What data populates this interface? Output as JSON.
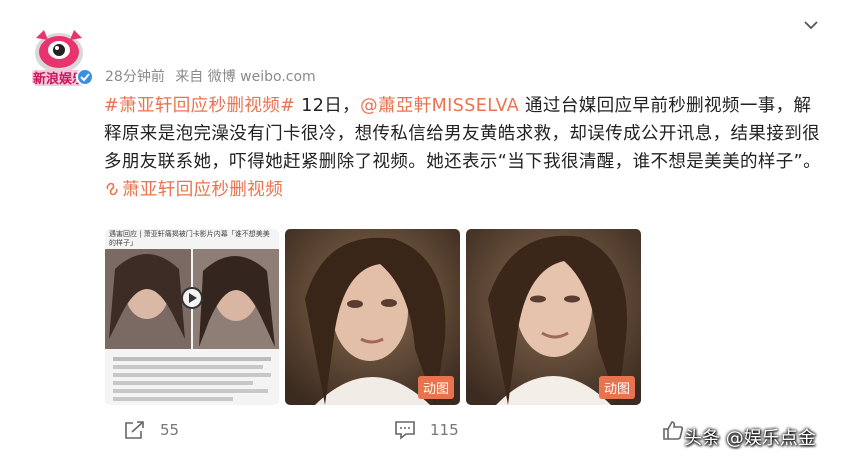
{
  "header": {
    "timestamp": "28分钟前",
    "source": "来自 微博 weibo.com"
  },
  "post": {
    "hashtag": "#萧亚轩回应秒删视频#",
    "date": " 12日，",
    "mention": "@蕭亞軒MISSELVA",
    "body1": " 通过台媒回应早前秒删视频一事，解释原来是泡完澡没有门卡很冷，想传私信给男友黄皓求救，却误传成公开讯息，结果接到很多朋友联系她，吓得她赶紧删除了视频。她还表示“当下我很清醒，谁不想是美美的样子”。",
    "topic_link": "萧亚轩回应秒删视频"
  },
  "media": {
    "thumb1_header": "遇害回应 | 萧亚轩痛揭被门卡影片内幕「谁不想美美的样子」",
    "badge2": "动图",
    "badge3": "动图"
  },
  "actions": {
    "share_count": "55",
    "comment_count": "115"
  },
  "watermark": "头条 @娱乐点金"
}
